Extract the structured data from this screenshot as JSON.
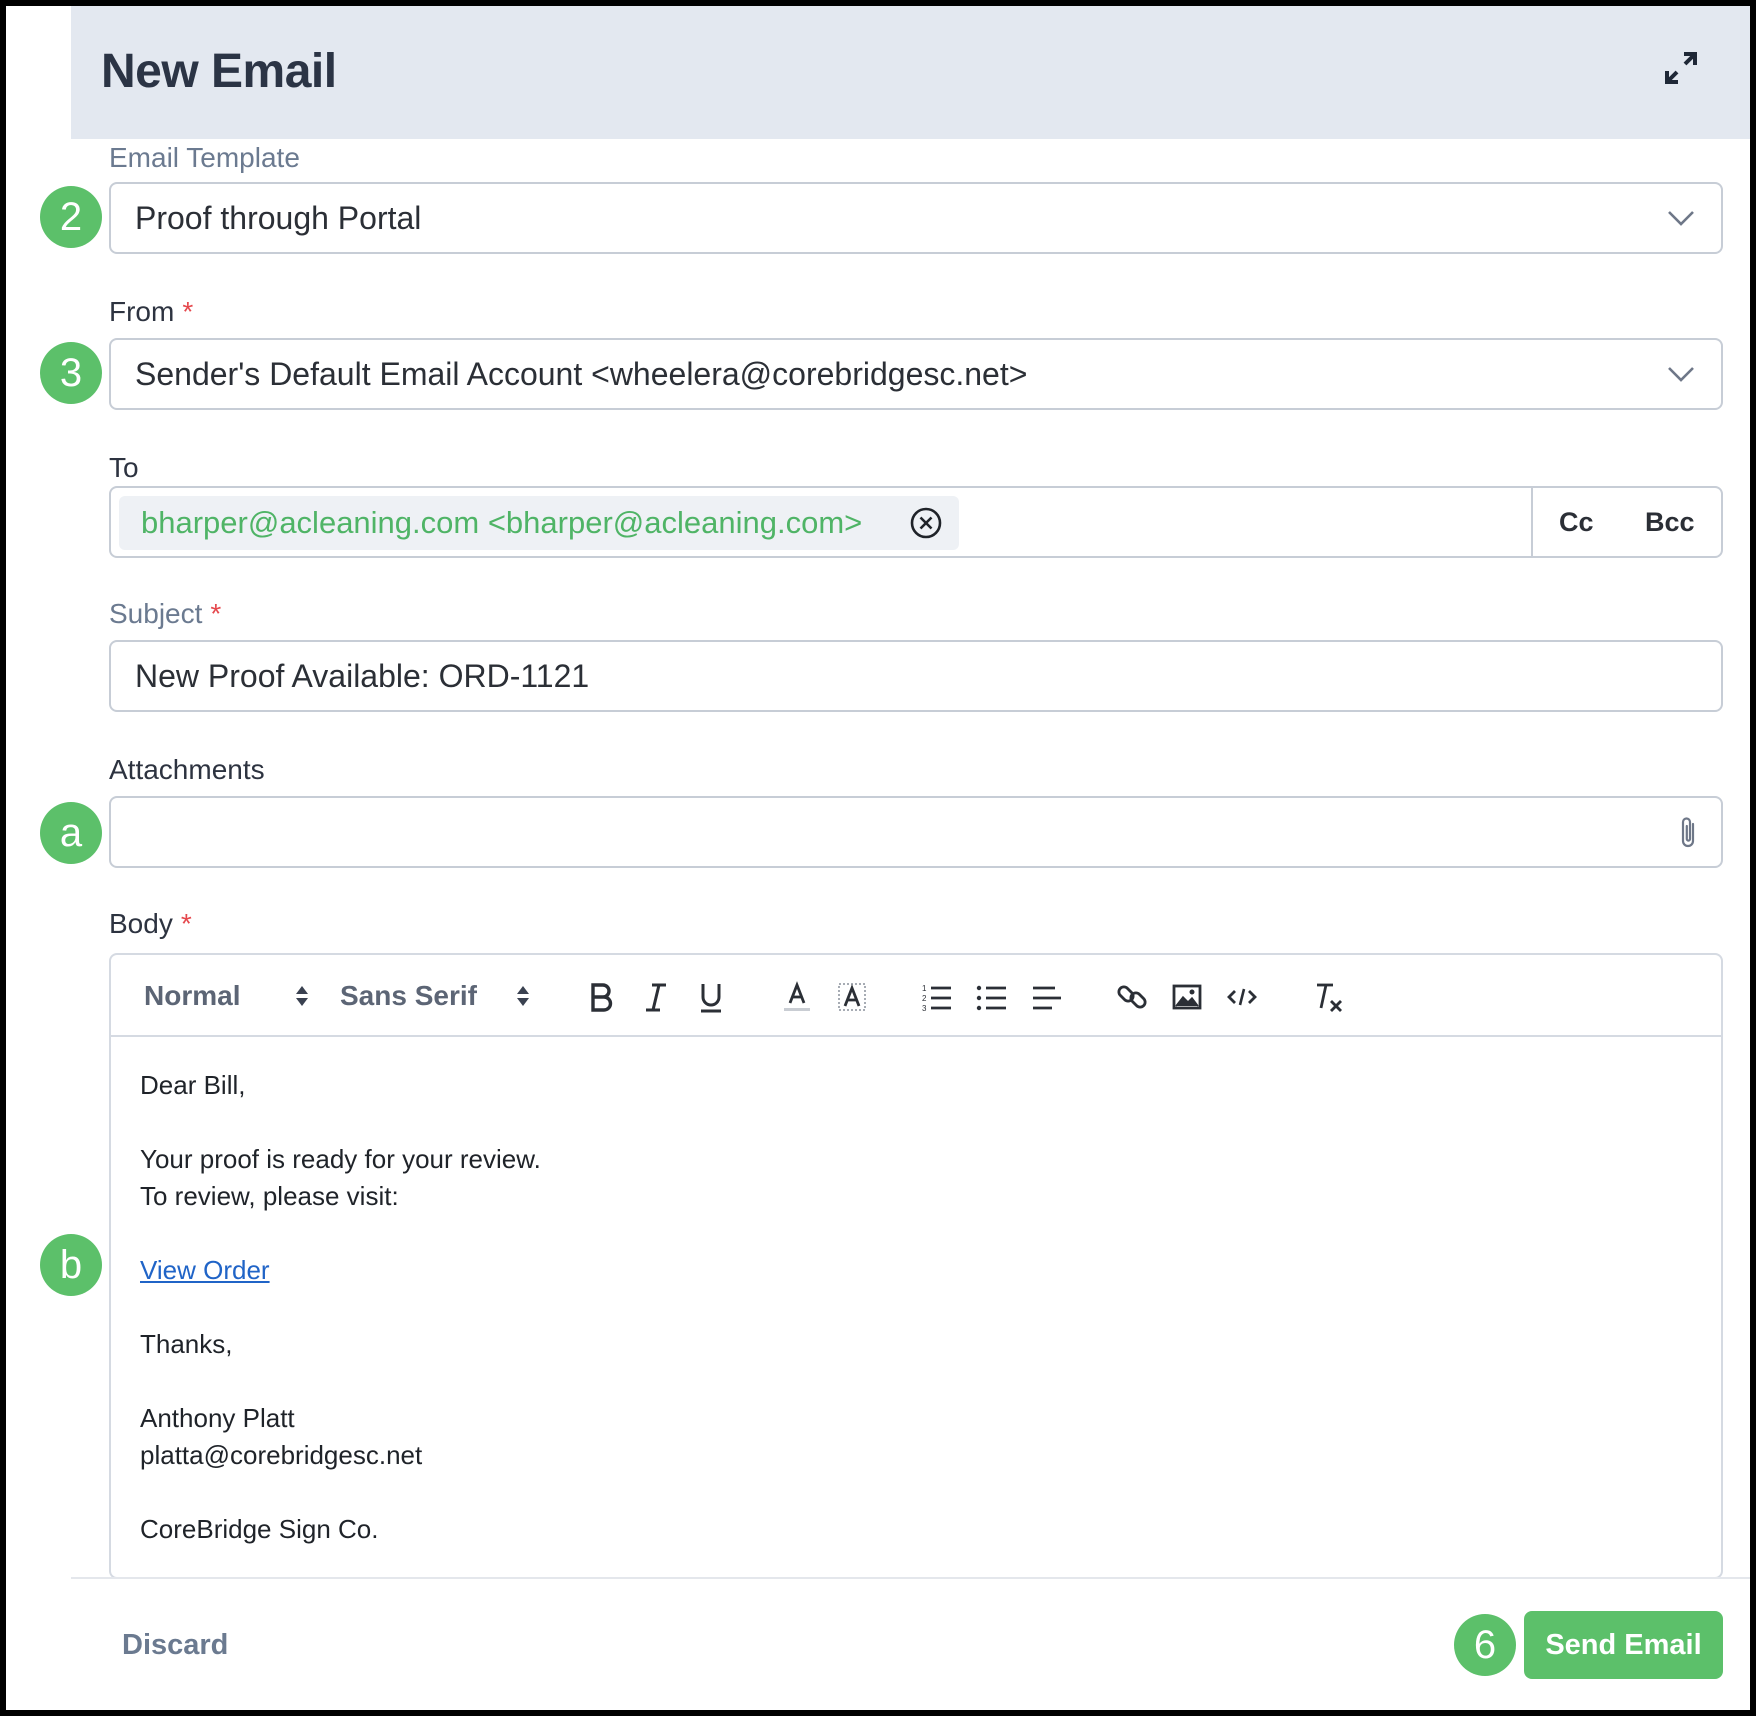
{
  "header": {
    "title": "New Email",
    "expand_icon": "expand-arrows-icon"
  },
  "annotations": {
    "badge_template": "2",
    "badge_from": "3",
    "badge_attachments": "a",
    "badge_body": "b",
    "badge_send": "6"
  },
  "template": {
    "label": "Email Template",
    "value": "Proof through Portal"
  },
  "from": {
    "label": "From",
    "required_mark": "*",
    "value": "Sender's Default Email Account <wheelera@corebridgesc.net>"
  },
  "to": {
    "label": "To",
    "recipient": "bharper@acleaning.com <bharper@acleaning.com>",
    "cc_label": "Cc",
    "bcc_label": "Bcc"
  },
  "subject": {
    "label": "Subject",
    "required_mark": "*",
    "value": "New Proof Available: ORD-1121"
  },
  "attachments": {
    "label": "Attachments",
    "value": ""
  },
  "body": {
    "label": "Body",
    "required_mark": "*",
    "toolbar": {
      "size": "Normal",
      "font": "Sans Serif"
    },
    "greeting": "Dear Bill,",
    "line1": "Your proof is ready for your review.",
    "line2": "To review, please visit:",
    "link": "View Order",
    "thanks": "Thanks,",
    "sig_name": "Anthony Platt",
    "sig_email": "platta@corebridgesc.net",
    "company": "CoreBridge Sign Co."
  },
  "footer": {
    "discard_label": "Discard",
    "send_label": "Send Email"
  },
  "colors": {
    "accent_green": "#5cc06a",
    "header_bg": "#e3e8f0",
    "required_red": "#e5484d",
    "link_blue": "#2064c7"
  }
}
